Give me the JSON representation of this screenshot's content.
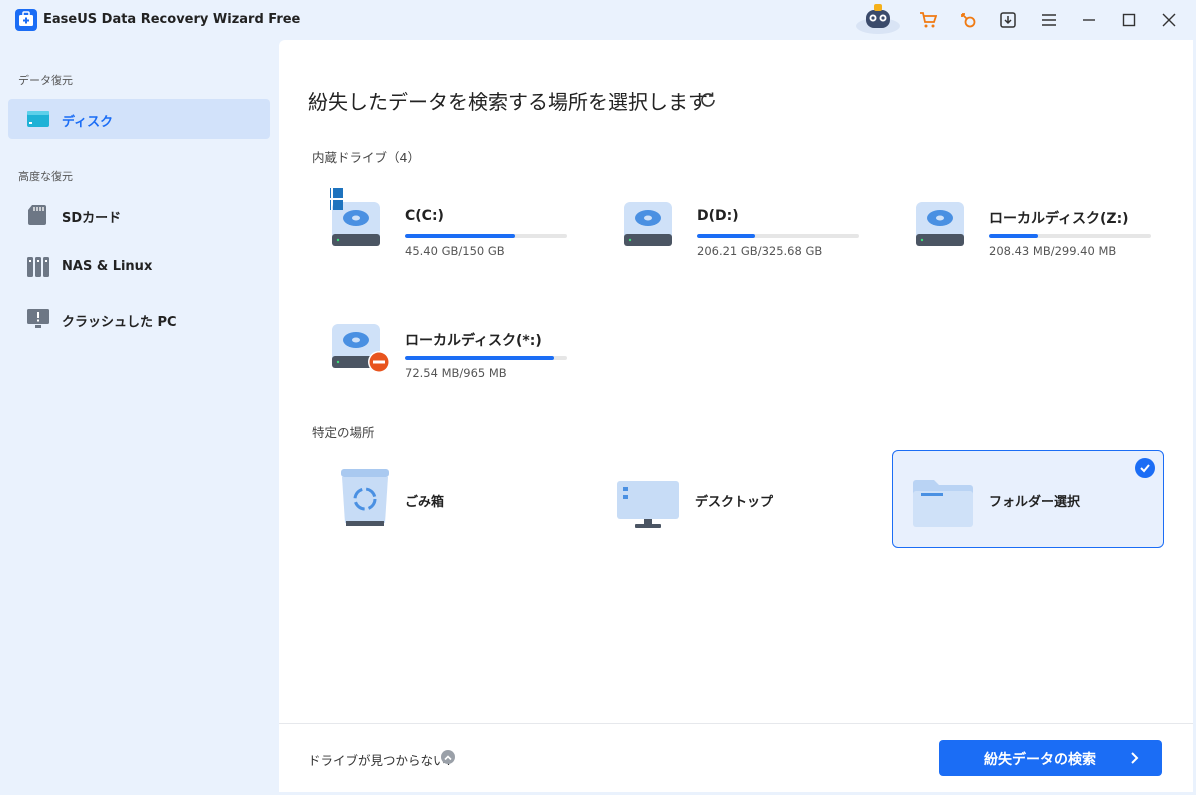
{
  "app": {
    "title": "EaseUS Data Recovery Wizard Free"
  },
  "titlebar": {
    "icons": [
      "mascot-icon",
      "cart-icon",
      "key-icon",
      "download-icon",
      "menu-icon",
      "minimize-icon",
      "maximize-icon",
      "close-icon"
    ]
  },
  "sidebar": {
    "section1": "データ復元",
    "section2": "高度な復元",
    "items": [
      {
        "label": "ディスク",
        "icon": "disk-icon",
        "active": true
      },
      {
        "label": "SDカード",
        "icon": "sd-card-icon"
      },
      {
        "label": "NAS & Linux",
        "icon": "nas-icon"
      },
      {
        "label": "クラッシュした PC",
        "icon": "crashed-pc-icon"
      }
    ]
  },
  "main": {
    "title": "紛失したデータを検索する場所を選択します",
    "internal_label": "内蔵ドライブ（4）",
    "drives": [
      {
        "name": "C(C:)",
        "size": "45.40 GB/150 GB",
        "used_fraction": 0.68
      },
      {
        "name": "D(D:)",
        "size": "206.21 GB/325.68 GB",
        "used_fraction": 0.36
      },
      {
        "name": "ローカルディスク(Z:)",
        "size": "208.43 MB/299.40 MB",
        "used_fraction": 0.3
      },
      {
        "name": "ローカルディスク(*:)",
        "size": "72.54 MB/965 MB",
        "used_fraction": 0.92
      }
    ],
    "specific_label": "特定の場所",
    "locations": [
      {
        "label": "ごみ箱",
        "icon": "recycle-bin-icon"
      },
      {
        "label": "デスクトップ",
        "icon": "desktop-icon"
      },
      {
        "label": "フォルダー選択",
        "icon": "folder-icon",
        "selected": true
      }
    ],
    "not_found": "ドライブが見つからない?",
    "scan_button": "紛失データの検索"
  },
  "colors": {
    "accent": "#1b6df5",
    "sidebar_bg": "#eaf2fd",
    "selected_bg": "#e8f0fd"
  }
}
